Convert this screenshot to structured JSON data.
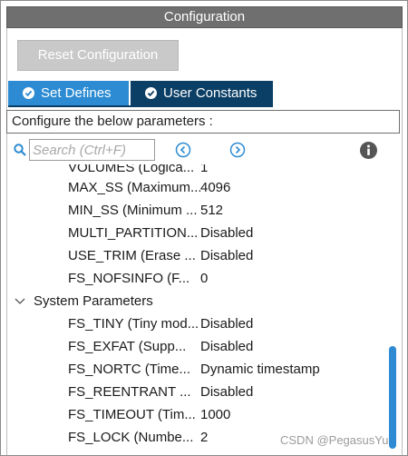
{
  "panel": {
    "title": "Configuration",
    "reset_label": "Reset Configuration"
  },
  "tabs": [
    {
      "label": "Set Defines",
      "active": true
    },
    {
      "label": "User Constants",
      "active": false
    }
  ],
  "description": "Configure the below parameters :",
  "search": {
    "placeholder": "Search (Ctrl+F)"
  },
  "rows": [
    {
      "name": "VOLUMES (Logica...",
      "value": "1"
    },
    {
      "name": "MAX_SS (Maximum...",
      "value": "4096"
    },
    {
      "name": "MIN_SS (Minimum ...",
      "value": "512"
    },
    {
      "name": "MULTI_PARTITION...",
      "value": "Disabled"
    },
    {
      "name": "USE_TRIM (Erase ...",
      "value": "Disabled"
    },
    {
      "name": "FS_NOFSINFO (F...",
      "value": "0"
    }
  ],
  "group": {
    "label": "System Parameters",
    "expanded": true
  },
  "group_rows": [
    {
      "name": "FS_TINY (Tiny mod...",
      "value": "Disabled"
    },
    {
      "name": "FS_EXFAT (Supp...",
      "value": "Disabled"
    },
    {
      "name": "FS_NORTC (Time...",
      "value": "Dynamic timestamp"
    },
    {
      "name": "FS_REENTRANT ...",
      "value": "Disabled"
    },
    {
      "name": "FS_TIMEOUT (Tim...",
      "value": "1000"
    },
    {
      "name": "FS_LOCK (Numbe...",
      "value": "2"
    }
  ],
  "watermark": "CSDN @PegasusYu",
  "colors": {
    "title_bar": "#6f6f6f",
    "tab_active": "#2c8bd2",
    "tab_inactive": "#0b3f66",
    "scroll_thumb": "#2e8bd3",
    "icon_blue": "#2c8bd2"
  },
  "icons": {
    "tab": "check-circle-icon",
    "search": "search-icon",
    "prev": "chevron-left-circle-icon",
    "next": "chevron-right-circle-icon",
    "info": "info-icon",
    "group": "chevron-down-icon"
  }
}
